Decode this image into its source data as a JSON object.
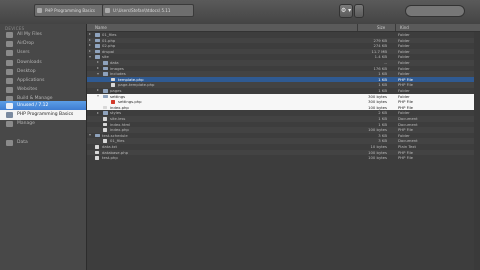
{
  "toolbar": {
    "path_left": "PHP Programming Basics",
    "path_right": "U:\\Users\\Stefan\\htdocs\\ 5.11",
    "action_label": "⚙ ▾",
    "search_placeholder": ""
  },
  "sidebar": {
    "devices_header": "DEVICES",
    "items": [
      {
        "label": "All My Files",
        "style": "normal"
      },
      {
        "label": "AirDrop",
        "style": "normal"
      },
      {
        "label": "Users",
        "style": "normal"
      },
      {
        "label": "Downloads",
        "style": "normal"
      },
      {
        "label": "Desktop",
        "style": "normal"
      },
      {
        "label": "Applications",
        "style": "normal"
      },
      {
        "label": "Websites",
        "style": "normal"
      },
      {
        "label": "Build & Manage",
        "style": "normal"
      },
      {
        "label": "Unused / 7.12",
        "style": "selected"
      },
      {
        "label": "PHP Programming Basics",
        "style": "white"
      },
      {
        "label": "Manage",
        "style": "normal"
      },
      {
        "label": "Data",
        "style": "normal"
      }
    ]
  },
  "columns": {
    "name": "Name",
    "size": "Size",
    "kind": "Kind"
  },
  "files": [
    {
      "name": "01_files",
      "size": "",
      "kind": "Folder",
      "depth": 0,
      "type": "folder",
      "expanded": false,
      "state": ""
    },
    {
      "name": "01.php",
      "size": "279 KB",
      "kind": "Folder",
      "depth": 0,
      "type": "folder",
      "expanded": false,
      "state": ""
    },
    {
      "name": "02.php",
      "size": "274 KB",
      "kind": "Folder",
      "depth": 0,
      "type": "folder",
      "expanded": false,
      "state": ""
    },
    {
      "name": "drupal",
      "size": "11.7 MB",
      "kind": "Folder",
      "depth": 0,
      "type": "folder",
      "expanded": false,
      "state": ""
    },
    {
      "name": "site",
      "size": "1.4 KB",
      "kind": "Folder",
      "depth": 0,
      "type": "folder",
      "expanded": true,
      "state": ""
    },
    {
      "name": "data",
      "size": "--",
      "kind": "Folder",
      "depth": 1,
      "type": "folder",
      "expanded": false,
      "state": ""
    },
    {
      "name": "images",
      "size": "176 KB",
      "kind": "Folder",
      "depth": 1,
      "type": "folder",
      "expanded": false,
      "state": ""
    },
    {
      "name": "includes",
      "size": "1 KB",
      "kind": "Folder",
      "depth": 1,
      "type": "folder",
      "expanded": true,
      "state": ""
    },
    {
      "name": "template.php",
      "size": "1 KB",
      "kind": "PHP File",
      "depth": 2,
      "type": "file",
      "expanded": false,
      "state": "selected"
    },
    {
      "name": "page-template.php",
      "size": "1 KB",
      "kind": "PHP File",
      "depth": 2,
      "type": "file",
      "expanded": false,
      "state": ""
    },
    {
      "name": "pages",
      "size": "1 KB",
      "kind": "Folder",
      "depth": 1,
      "type": "folder",
      "expanded": false,
      "state": ""
    },
    {
      "name": "settings",
      "size": "300 bytes",
      "kind": "Folder",
      "depth": 1,
      "type": "folder",
      "expanded": true,
      "state": "highlight"
    },
    {
      "name": "settings.php",
      "size": "300 bytes",
      "kind": "PHP File",
      "depth": 2,
      "type": "flag",
      "expanded": false,
      "state": "highlight"
    },
    {
      "name": "index.php",
      "size": "100 bytes",
      "kind": "PHP File",
      "depth": 1,
      "type": "file",
      "expanded": false,
      "state": "highlight"
    },
    {
      "name": "styles",
      "size": "2 KB",
      "kind": "Folder",
      "depth": 1,
      "type": "folder",
      "expanded": false,
      "state": ""
    },
    {
      "name": "site.less",
      "size": "1 KB",
      "kind": "Document",
      "depth": 1,
      "type": "file",
      "expanded": false,
      "state": ""
    },
    {
      "name": "index.html",
      "size": "1 KB",
      "kind": "Document",
      "depth": 1,
      "type": "file",
      "expanded": false,
      "state": ""
    },
    {
      "name": "index.php",
      "size": "100 bytes",
      "kind": "PHP File",
      "depth": 1,
      "type": "file",
      "expanded": false,
      "state": ""
    },
    {
      "name": "test-schedule",
      "size": "3 KB",
      "kind": "Folder",
      "depth": 0,
      "type": "folder",
      "expanded": true,
      "state": ""
    },
    {
      "name": "01_files",
      "size": "3 KB",
      "kind": "Document",
      "depth": 1,
      "type": "file",
      "expanded": false,
      "state": ""
    },
    {
      "name": "data.txt",
      "size": "10 bytes",
      "kind": "Plain Text",
      "depth": 0,
      "type": "file",
      "expanded": false,
      "state": ""
    },
    {
      "name": "database.php",
      "size": "100 bytes",
      "kind": "PHP File",
      "depth": 0,
      "type": "file",
      "expanded": false,
      "state": ""
    },
    {
      "name": "test.php",
      "size": "100 bytes",
      "kind": "PHP File",
      "depth": 0,
      "type": "file",
      "expanded": false,
      "state": ""
    }
  ]
}
